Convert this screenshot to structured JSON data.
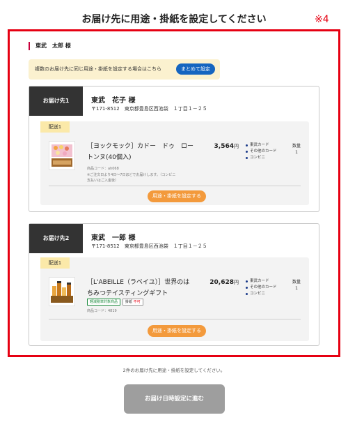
{
  "page": {
    "title": "お届け先に用途・掛紙を設定してください",
    "note_mark": "※4"
  },
  "customer": {
    "name": "東武　太郎 様"
  },
  "bulk": {
    "text": "複数のお届け先に同じ用途・掛紙を設定する場合はこちら",
    "button": "まとめて設定"
  },
  "destinations": [
    {
      "tag": "お届け先1",
      "name": "東武　花子 様",
      "address": "〒171-8512　東京都豊島区西池袋　１丁目１－２５",
      "shipment_label": "配送1",
      "product": {
        "name": "［ヨックモック］カドー　ドゥ　ロートンヌ(40個入)",
        "price": "3,564",
        "price_unit": "円",
        "price_tax": "(税込)",
        "code": "商品コード：ah068",
        "note": "※ご注文日より4日〜7日ほどでお届けします。（コンビニ支払いはご入金後）"
      },
      "payments": [
        "東武カード",
        "その他のカード",
        "コンビニ"
      ],
      "qty_label": "数量",
      "qty_value": "1",
      "set_button": "用途・掛紙を設定する",
      "colors": {
        "box": "#e6b87a"
      }
    },
    {
      "tag": "お届け先2",
      "name": "東武　一郎 様",
      "address": "〒171-8512　東京都豊島区西池袋　１丁目１－２５",
      "shipment_label": "配送1",
      "product": {
        "name": "［L'ABEILLE（ラベイユ）］世界のはちみつテイスティングギフト",
        "price": "20,628",
        "price_unit": "円",
        "price_tax": "(税込)",
        "code": "商品コード：4819",
        "badge_tax": "軽減税率対象商品",
        "badge_wrap_prefix": "掛紙",
        "badge_wrap_suffix": "不可"
      },
      "payments": [
        "東武カード",
        "その他のカード",
        "コンビニ"
      ],
      "qty_label": "数量",
      "qty_value": "1",
      "set_button": "用途・掛紙を設定する",
      "colors": {
        "box": "#c98a2a"
      }
    }
  ],
  "footer": {
    "status": "2件のお届け先に用途・掛紙を設定してください。",
    "proceed_button": "お届け日時設定に進む"
  },
  "colors": {
    "frame_red": "#e60012",
    "bulk_button": "#1565c0",
    "orange_button": "#f39a3c",
    "proceed_button": "#9e9e9e",
    "tag_dark": "#333333"
  }
}
